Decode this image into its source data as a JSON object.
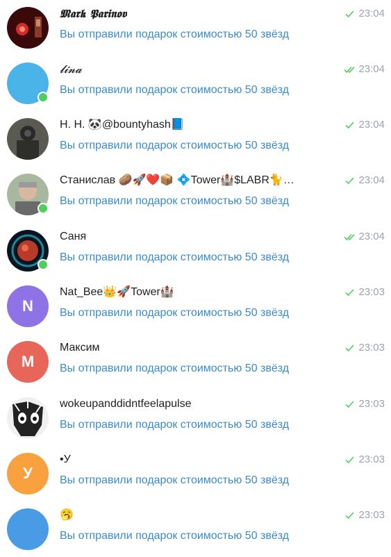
{
  "chats": [
    {
      "name": "𝕸𝖆𝖗𝖐 𝕻𝖆𝖗𝖎𝖓𝖔𝖛",
      "message": "Вы отправили подарок стоимостью 50 звёзд",
      "time": "23:04",
      "check": "single",
      "avatar_letter": "",
      "avatar_color": "#7a1a1a",
      "online": false,
      "style": "gothic"
    },
    {
      "name": "𝓵𝓲𝓷𝓪",
      "message": "Вы отправили подарок стоимостью 50 звёзд",
      "time": "23:04",
      "check": "double",
      "avatar_letter": "",
      "avatar_color": "#4ab3e8",
      "online": true,
      "style": "script"
    },
    {
      "name": "Н. Н. 🐼@bountyhash📘",
      "message": "Вы отправили подарок стоимостью 50 звёзд",
      "time": "23:04",
      "check": "single",
      "avatar_letter": "",
      "avatar_color": "#3a3a3a",
      "online": false,
      "style": "normal"
    },
    {
      "name": "Станислав 🥔🚀❤️📦 💠Tower🏰$LABR🐈…",
      "message": "Вы отправили подарок стоимостью 50 звёзд",
      "time": "23:04",
      "check": "single",
      "avatar_letter": "",
      "avatar_color": "#8a9a8a",
      "online": true,
      "style": "normal"
    },
    {
      "name": "Саня",
      "message": "Вы отправили подарок стоимостью 50 звёзд",
      "time": "23:04",
      "check": "double",
      "avatar_letter": "",
      "avatar_color": "#1a2a3a",
      "online": true,
      "style": "normal"
    },
    {
      "name": "Nat_Bee👑🚀Tower🏰",
      "message": "Вы отправили подарок стоимостью 50 звёзд",
      "time": "23:03",
      "check": "single",
      "avatar_letter": "N",
      "avatar_color": "#8e72e6",
      "online": false,
      "style": "normal"
    },
    {
      "name": "Максим",
      "message": "Вы отправили подарок стоимостью 50 звёзд",
      "time": "23:03",
      "check": "single",
      "avatar_letter": "M",
      "avatar_color": "#e8655a",
      "online": false,
      "style": "normal"
    },
    {
      "name": "wokeupanddidntfeelapulse",
      "message": "Вы отправили подарок стоимостью 50 звёзд",
      "time": "23:03",
      "check": "single",
      "avatar_letter": "",
      "avatar_color": "#dddddd",
      "online": false,
      "style": "normal"
    },
    {
      "name": "•У",
      "message": "Вы отправили подарок стоимостью 50 звёзд",
      "time": "23:03",
      "check": "single",
      "avatar_letter": "У",
      "avatar_color": "#f9a03f",
      "online": false,
      "style": "normal"
    },
    {
      "name": "🥱",
      "message": "Вы отправили подарок стоимостью 50 звёзд",
      "time": "23:03",
      "check": "single",
      "avatar_letter": "",
      "avatar_color": "#4a9be6",
      "online": false,
      "style": "normal"
    }
  ],
  "colors": {
    "accent_text": "#3a8cc9",
    "check_green": "#4fce5d",
    "online": "#4fce5d"
  }
}
